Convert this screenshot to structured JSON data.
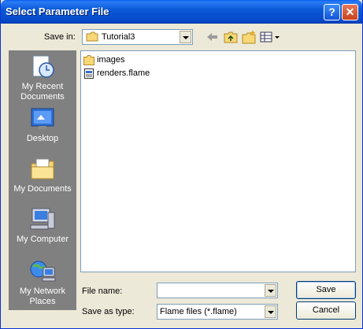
{
  "window": {
    "title": "Select Parameter File"
  },
  "toolbar": {
    "save_in_label": "Save in:",
    "save_in_value": "Tutorial3"
  },
  "places": [
    {
      "label": "My Recent Documents",
      "icon": "recent-documents-icon"
    },
    {
      "label": "Desktop",
      "icon": "desktop-icon"
    },
    {
      "label": "My Documents",
      "icon": "my-documents-icon"
    },
    {
      "label": "My Computer",
      "icon": "my-computer-icon"
    },
    {
      "label": "My Network Places",
      "icon": "network-places-icon"
    }
  ],
  "files": [
    {
      "name": "images",
      "type": "folder"
    },
    {
      "name": "renders.flame",
      "type": "file"
    }
  ],
  "footer": {
    "file_name_label": "File name:",
    "file_name_value": "",
    "save_type_label": "Save as type:",
    "save_type_value": "Flame files (*.flame)",
    "save_button": "Save",
    "cancel_button": "Cancel"
  },
  "colors": {
    "title_blue": "#0a5ad8",
    "close_red": "#c8421c",
    "places_gray": "#808080"
  }
}
